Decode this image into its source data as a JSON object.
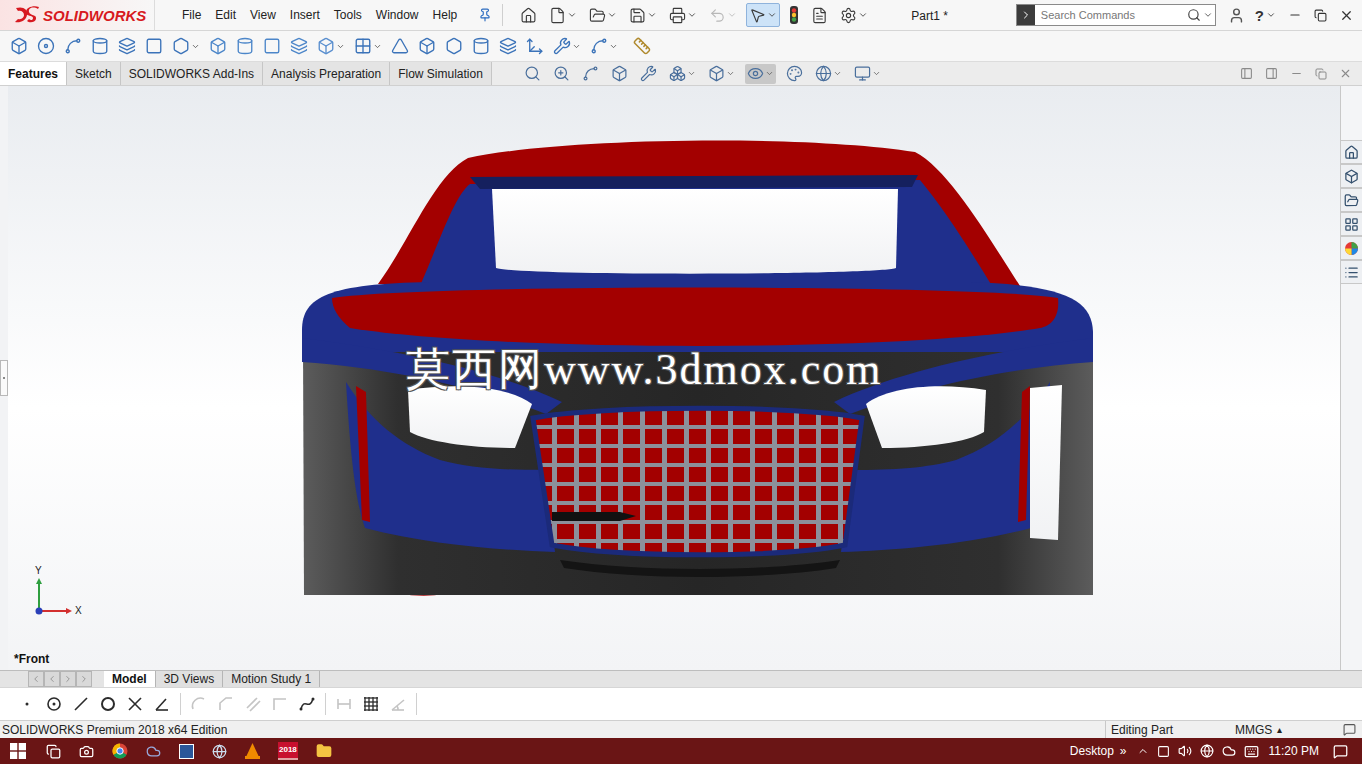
{
  "app": {
    "logo": "SOLIDWORKS",
    "document_title": "Part1 *"
  },
  "menu": [
    "File",
    "Edit",
    "View",
    "Insert",
    "Tools",
    "Window",
    "Help"
  ],
  "quick_access": [
    {
      "kind": "home",
      "disabled": false,
      "selected": false
    },
    {
      "kind": "new",
      "disabled": false,
      "selected": false
    },
    {
      "kind": "open",
      "disabled": false,
      "selected": false
    },
    {
      "kind": "save",
      "disabled": false,
      "selected": false
    },
    {
      "kind": "print",
      "disabled": false,
      "selected": false
    },
    {
      "kind": "undo",
      "disabled": true,
      "selected": false
    },
    {
      "kind": "select",
      "disabled": false,
      "selected": true
    },
    {
      "kind": "rebuild",
      "disabled": false,
      "selected": false
    },
    {
      "kind": "properties",
      "disabled": false,
      "selected": false
    },
    {
      "kind": "options",
      "disabled": false,
      "selected": false
    }
  ],
  "search": {
    "placeholder": "Search Commands"
  },
  "help_button": "?",
  "command_tabs": [
    {
      "label": "Features",
      "selected": true
    },
    {
      "label": "Sketch",
      "selected": false
    },
    {
      "label": "SOLIDWORKS Add-Ins",
      "selected": false
    },
    {
      "label": "Analysis Preparation",
      "selected": false
    },
    {
      "label": "Flow Simulation",
      "selected": false
    }
  ],
  "viewport": {
    "view_label": "*Front",
    "watermark": "莫西网www.3dmox.com",
    "triad": {
      "y": "Y",
      "x": "X"
    }
  },
  "bottom_tabs": [
    {
      "label": "Model",
      "selected": true
    },
    {
      "label": "3D Views",
      "selected": false
    },
    {
      "label": "Motion Study 1",
      "selected": false
    }
  ],
  "sketch_tools": [
    {
      "kind": "point",
      "disabled": false
    },
    {
      "kind": "circle-center",
      "disabled": false
    },
    {
      "kind": "line",
      "disabled": false
    },
    {
      "kind": "circle",
      "disabled": false
    },
    {
      "kind": "trim",
      "disabled": false
    },
    {
      "kind": "angle",
      "disabled": false
    },
    {
      "kind": "arc",
      "disabled": true
    },
    {
      "kind": "chamfer",
      "disabled": true
    },
    {
      "kind": "offset",
      "disabled": true
    },
    {
      "kind": "corner",
      "disabled": true
    },
    {
      "kind": "spline",
      "disabled": false
    },
    {
      "kind": "dimension",
      "disabled": true
    },
    {
      "kind": "grid",
      "disabled": false
    },
    {
      "kind": "relation",
      "disabled": true
    }
  ],
  "status_bar": {
    "edition": "SOLIDWORKS Premium 2018 x64 Edition",
    "mode": "Editing Part",
    "units": "MMGS",
    "units_menu": "▴"
  },
  "taskbar": {
    "app_badge": "2018",
    "desktop": "Desktop",
    "overflow": "»",
    "time": "11:20 PM"
  }
}
